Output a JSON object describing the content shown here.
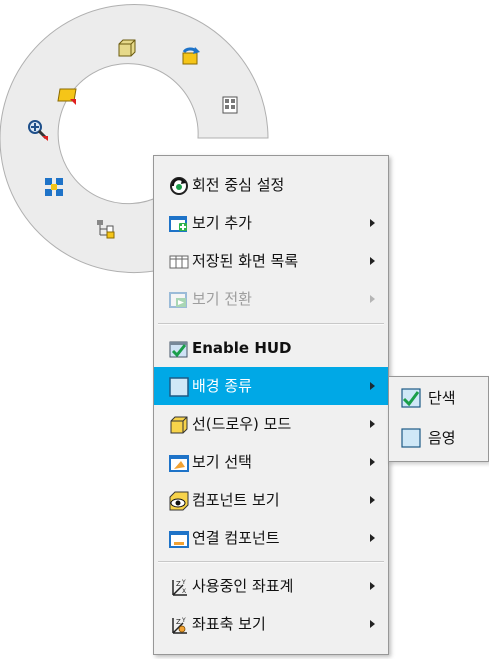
{
  "marking_menu": {
    "icons": [
      "fit-icon",
      "zoom-window-icon",
      "pan-icon",
      "rotate-view-icon",
      "named-views-icon",
      "zoom-in-icon",
      "zoom-all-icon",
      "properties-icon"
    ]
  },
  "context_menu": {
    "items": [
      {
        "label": "회전 중심 설정",
        "icon": "rotation-center-icon",
        "submenu": false,
        "enabled": true
      },
      {
        "label": "보기 추가",
        "icon": "add-view-icon",
        "submenu": true,
        "enabled": true
      },
      {
        "label": "저장된 화면 목록",
        "icon": "saved-views-icon",
        "submenu": true,
        "enabled": true
      },
      {
        "label": "보기 전환",
        "icon": "switch-view-icon",
        "submenu": true,
        "enabled": false
      },
      {
        "label": "Enable HUD",
        "icon": "hud-checkbox-icon",
        "submenu": false,
        "enabled": true
      },
      {
        "label": "배경 종류",
        "icon": "background-type-icon",
        "submenu": true,
        "enabled": true,
        "highlighted": true
      },
      {
        "label": "선(드로우) 모드",
        "icon": "draw-mode-icon",
        "submenu": true,
        "enabled": true
      },
      {
        "label": "보기 선택",
        "icon": "view-select-icon",
        "submenu": true,
        "enabled": true
      },
      {
        "label": "컴포넌트 보기",
        "icon": "component-view-icon",
        "submenu": true,
        "enabled": true
      },
      {
        "label": "연결 컴포넌트",
        "icon": "linked-component-icon",
        "submenu": true,
        "enabled": true
      },
      {
        "label": "사용중인 좌표계",
        "icon": "active-coordinate-system-icon",
        "submenu": true,
        "enabled": true
      },
      {
        "label": "좌표축 보기",
        "icon": "show-axes-icon",
        "submenu": true,
        "enabled": true
      }
    ]
  },
  "submenu": {
    "items": [
      {
        "label": "단색",
        "icon": "solid-color-check-icon",
        "checked": true
      },
      {
        "label": "음영",
        "icon": "gradient-icon",
        "checked": false
      }
    ]
  },
  "colors": {
    "highlight": "#00a8e6",
    "menu_bg": "#f0f0f0",
    "marking_menu_bg": "#ececec"
  }
}
